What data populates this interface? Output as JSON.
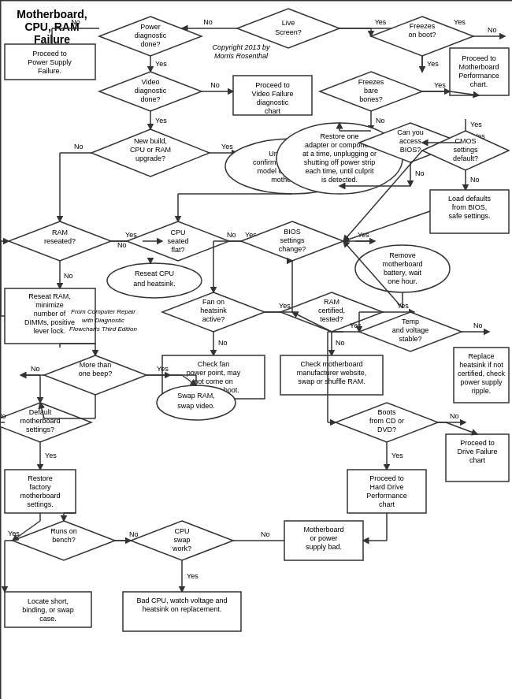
{
  "title": "Motherboard, CPU, RAM Failure",
  "copyright": "Copyright 2013 by Morris Rosenthal",
  "from_text": "From Computer Repair with Diagnostic Flowcharts Third Edition"
}
